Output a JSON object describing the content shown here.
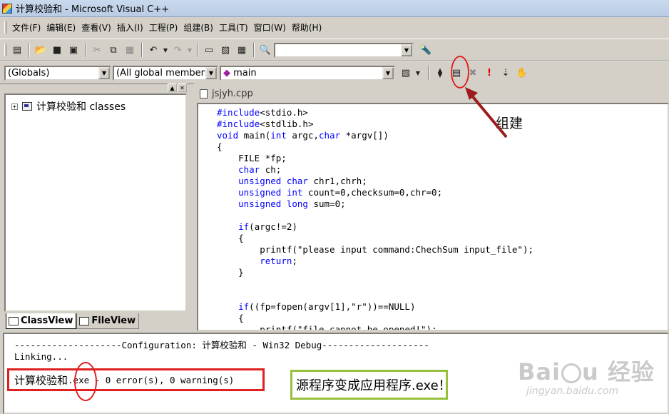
{
  "window": {
    "title": "计算校验和 - Microsoft Visual C++"
  },
  "menu": [
    "文件(F)",
    "编辑(E)",
    "查看(V)",
    "插入(I)",
    "工程(P)",
    "组建(B)",
    "工具(T)",
    "窗口(W)",
    "帮助(H)"
  ],
  "toolbar": {
    "find_combo_value": "",
    "globals_combo": "(Globals)",
    "members_combo": "(All global members",
    "function_combo": "main"
  },
  "workspace": {
    "tree_root": "计算校验和 classes",
    "tabs": [
      "ClassView",
      "FileView"
    ]
  },
  "editor": {
    "file_tab": "jsjyh.cpp",
    "lines": [
      "#include<stdio.h>",
      "#include<stdlib.h>",
      "void main(int argc,char *argv[])",
      "{",
      "    FILE *fp;",
      "    char ch;",
      "    unsigned char chr1,chrh;",
      "    unsigned int count=0,checksum=0,chr=0;",
      "    unsigned long sum=0;",
      "",
      "    if(argc!=2)",
      "    {",
      "        printf(\"please input command:ChechSum input_file\");",
      "        return;",
      "    }",
      "",
      "",
      "    if((fp=fopen(argv[1],\"r\"))==NULL)",
      "    {",
      "        printf(\"file cannot be opened!\");"
    ]
  },
  "output": {
    "config_line": "--------------------Configuration: 计算校验和 - Win32 Debug--------------------",
    "linking_line": "Linking...",
    "result_project": "计算校验和",
    "result_ext": ".exe",
    "result_rest": " - 0 error(s), 0 warning(s)"
  },
  "annotations": {
    "build_label": "组建",
    "note": "源程序变成应用程序.exe！",
    "red": "#e02020",
    "green": "#98c03c"
  },
  "watermark": {
    "logo": "Baidu经验",
    "url": "jingyan.baidu.com"
  }
}
